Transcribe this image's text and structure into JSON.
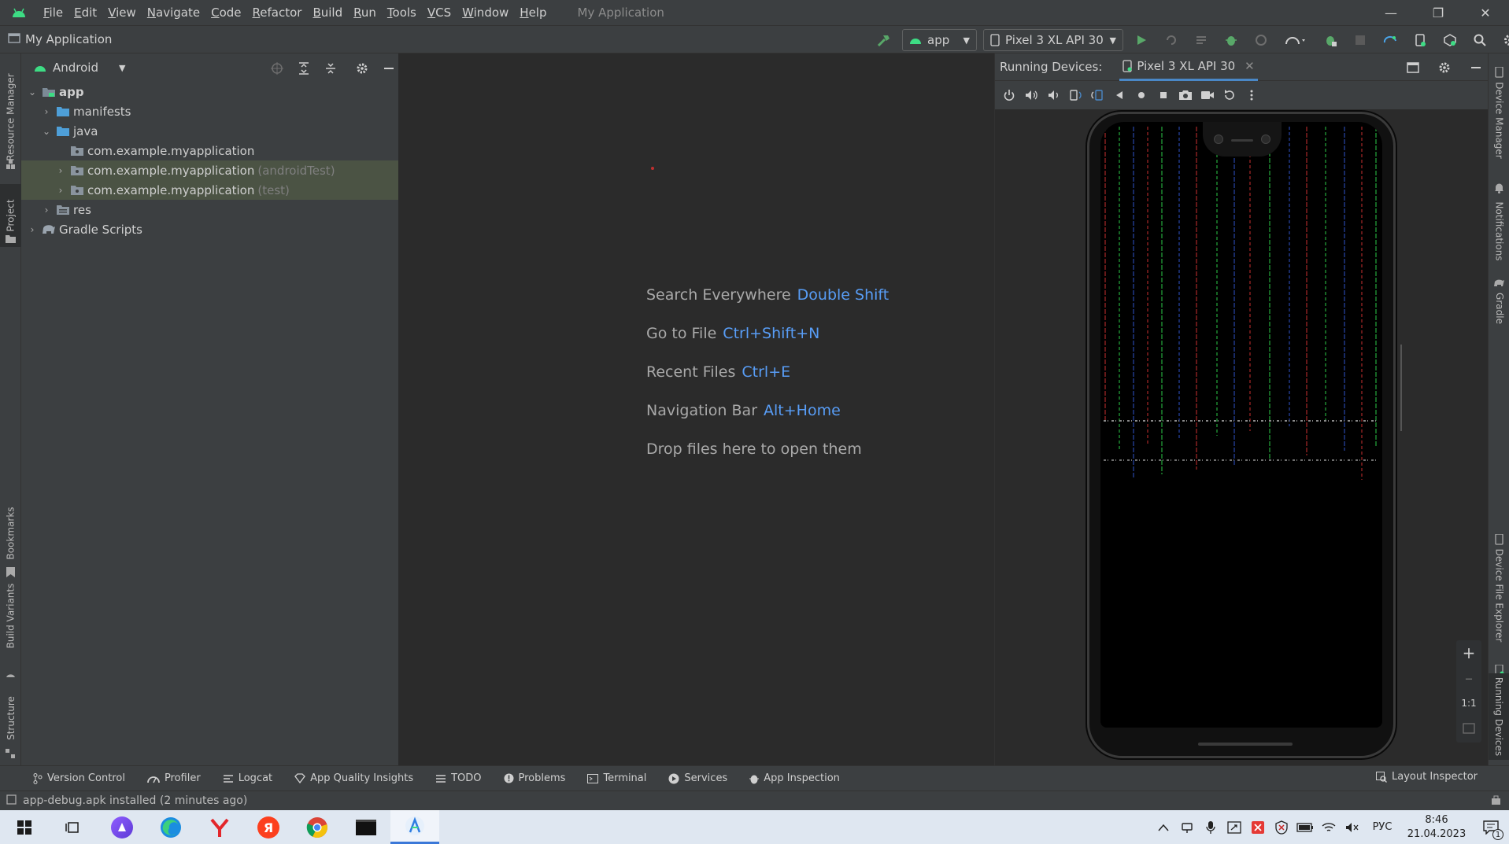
{
  "menu": {
    "items": [
      "File",
      "Edit",
      "View",
      "Navigate",
      "Code",
      "Refactor",
      "Build",
      "Run",
      "Tools",
      "VCS",
      "Window",
      "Help"
    ],
    "window_title": "My Application"
  },
  "navbar": {
    "project_name": "My Application",
    "run_config": "app",
    "device": "Pixel 3 XL API 30"
  },
  "left_strip": {
    "tabs": [
      "Resource Manager",
      "Project",
      "Bookmarks",
      "Build Variants",
      "Structure"
    ]
  },
  "right_strip": {
    "tabs": [
      "Device Manager",
      "Notifications",
      "Gradle",
      "Device File Explorer",
      "Running Devices"
    ]
  },
  "project": {
    "view_mode": "Android",
    "tree": [
      {
        "label": "app",
        "extra": ""
      },
      {
        "label": "manifests",
        "extra": ""
      },
      {
        "label": "java",
        "extra": ""
      },
      {
        "label": "com.example.myapplication",
        "extra": ""
      },
      {
        "label": "com.example.myapplication",
        "extra": "(androidTest)"
      },
      {
        "label": "com.example.myapplication",
        "extra": "(test)"
      },
      {
        "label": "res",
        "extra": ""
      },
      {
        "label": "Gradle Scripts",
        "extra": ""
      }
    ]
  },
  "editor": {
    "hints": [
      {
        "text": "Search Everywhere",
        "shortcut": "Double Shift"
      },
      {
        "text": "Go to File",
        "shortcut": "Ctrl+Shift+N"
      },
      {
        "text": "Recent Files",
        "shortcut": "Ctrl+E"
      },
      {
        "text": "Navigation Bar",
        "shortcut": "Alt+Home"
      },
      {
        "text": "Drop files here to open them",
        "shortcut": ""
      }
    ]
  },
  "devices": {
    "header_label": "Running Devices:",
    "tab_label": "Pixel 3 XL API 30",
    "zoom_one_to_one": "1:1"
  },
  "bottom_tabs": [
    "Version Control",
    "Profiler",
    "Logcat",
    "App Quality Insights",
    "TODO",
    "Problems",
    "Terminal",
    "Services",
    "App Inspection"
  ],
  "layout_inspector": "Layout Inspector",
  "status": {
    "message": "app-debug.apk installed (2 minutes ago)"
  },
  "taskbar": {
    "lang": "РУС",
    "time": "8:46",
    "date": "21.04.2023",
    "notification_count": "1"
  },
  "colors": {
    "accent_blue": "#589df6",
    "android_green": "#3ddc84",
    "run_green": "#59a869"
  }
}
